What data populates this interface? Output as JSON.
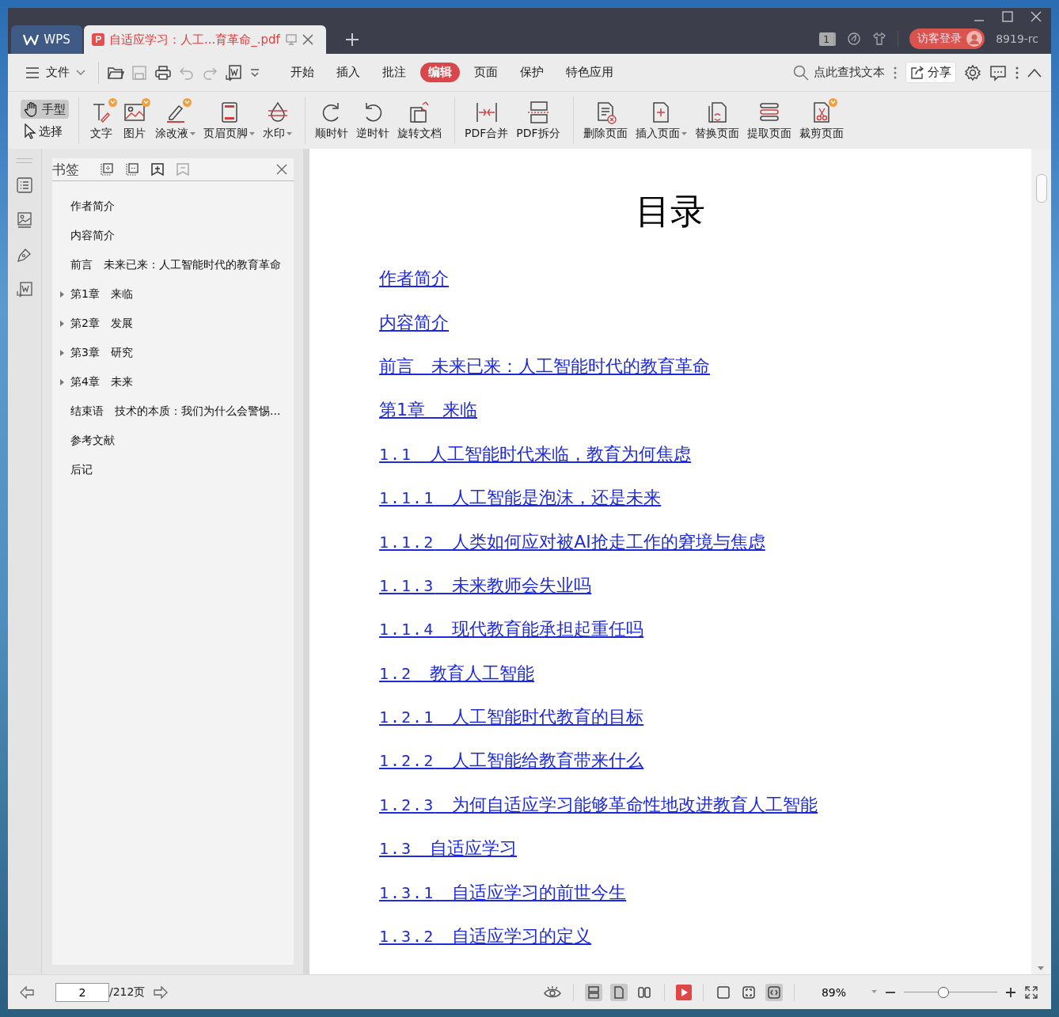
{
  "window": {
    "tabs": [
      {
        "kind": "home",
        "label": "WPS",
        "selected": false
      },
      {
        "kind": "pdf",
        "label": "自适应学习：人工...育革命_.pdf",
        "selected": true
      }
    ],
    "badge": "1",
    "login": "访客登录",
    "user": "8919-rc"
  },
  "menu": {
    "file": "文件",
    "tabs": [
      {
        "label": "开始",
        "selected": false
      },
      {
        "label": "插入",
        "selected": false
      },
      {
        "label": "批注",
        "selected": false
      },
      {
        "label": "编辑",
        "selected": true
      },
      {
        "label": "页面",
        "selected": false
      },
      {
        "label": "保护",
        "selected": false
      },
      {
        "label": "特色应用",
        "selected": false
      }
    ],
    "search": "点此查找文本",
    "share": "分享"
  },
  "toolbar": {
    "modes": [
      {
        "kind": "hand",
        "label": "手型",
        "selected": true
      },
      {
        "kind": "select",
        "label": "选择",
        "selected": false
      }
    ],
    "groups": [
      [
        {
          "kind": "text",
          "label": "文字",
          "dropdown": false,
          "badge": true
        },
        {
          "kind": "image",
          "label": "图片",
          "dropdown": false,
          "badge": true
        },
        {
          "kind": "correction",
          "label": "涂改液",
          "dropdown": true,
          "badge": true
        },
        {
          "kind": "header",
          "label": "页眉页脚",
          "dropdown": true,
          "badge": false
        },
        {
          "kind": "watermark",
          "label": "水印",
          "dropdown": true,
          "badge": false
        }
      ],
      [
        {
          "kind": "cw",
          "label": "顺时针",
          "dropdown": false,
          "badge": false
        },
        {
          "kind": "ccw",
          "label": "逆时针",
          "dropdown": false,
          "badge": false
        },
        {
          "kind": "rotate",
          "label": "旋转文档",
          "dropdown": false,
          "badge": false
        }
      ],
      [
        {
          "kind": "merge",
          "label": "PDF合并",
          "dropdown": false,
          "badge": false
        },
        {
          "kind": "split",
          "label": "PDF拆分",
          "dropdown": false,
          "badge": false
        }
      ],
      [
        {
          "kind": "delete",
          "label": "删除页面",
          "dropdown": false,
          "badge": false
        },
        {
          "kind": "insert",
          "label": "插入页面",
          "dropdown": true,
          "badge": false
        },
        {
          "kind": "replace",
          "label": "替换页面",
          "dropdown": false,
          "badge": false
        },
        {
          "kind": "extract",
          "label": "提取页面",
          "dropdown": false,
          "badge": false
        },
        {
          "kind": "crop",
          "label": "裁剪页面",
          "dropdown": false,
          "badge": true
        }
      ]
    ]
  },
  "bookmarks": {
    "title": "书签",
    "items": [
      {
        "label": "作者简介",
        "has_children": false
      },
      {
        "label": "内容简介",
        "has_children": false
      },
      {
        "label": "前言　未来已来：人工智能时代的教育革命",
        "has_children": false
      },
      {
        "label": "第1章　来临",
        "has_children": true
      },
      {
        "label": "第2章　发展",
        "has_children": true
      },
      {
        "label": "第3章　研究",
        "has_children": true
      },
      {
        "label": "第4章　未来",
        "has_children": true
      },
      {
        "label": "结束语　技术的本质：我们为什么会警惕...",
        "has_children": false
      },
      {
        "label": "参考文献",
        "has_children": false
      },
      {
        "label": "后记",
        "has_children": false
      }
    ]
  },
  "document": {
    "title": "目录",
    "toc": [
      {
        "kind": "plain",
        "text": "作者简介"
      },
      {
        "kind": "plain",
        "text": "内容简介"
      },
      {
        "kind": "plain",
        "text": "前言　未来已来：人工智能时代的教育革命"
      },
      {
        "kind": "plain",
        "text": "第1章　来临"
      },
      {
        "kind": "numbered",
        "number": "1.1",
        "text": "人工智能时代来临，教育为何焦虑"
      },
      {
        "kind": "numbered",
        "number": "1.1.1",
        "text": "人工智能是泡沫，还是未来"
      },
      {
        "kind": "numbered",
        "number": "1.1.2",
        "text": "人类如何应对被AI抢走工作的窘境与焦虑"
      },
      {
        "kind": "numbered",
        "number": "1.1.3",
        "text": "未来教师会失业吗"
      },
      {
        "kind": "numbered",
        "number": "1.1.4",
        "text": "现代教育能承担起重任吗"
      },
      {
        "kind": "numbered",
        "number": "1.2",
        "text": "教育人工智能"
      },
      {
        "kind": "numbered",
        "number": "1.2.1",
        "text": "人工智能时代教育的目标"
      },
      {
        "kind": "numbered",
        "number": "1.2.2",
        "text": "人工智能给教育带来什么"
      },
      {
        "kind": "numbered",
        "number": "1.2.3",
        "text": "为何自适应学习能够革命性地改进教育人工智能"
      },
      {
        "kind": "numbered",
        "number": "1.3",
        "text": "自适应学习"
      },
      {
        "kind": "numbered",
        "number": "1.3.1",
        "text": "自适应学习的前世今生"
      },
      {
        "kind": "numbered",
        "number": "1.3.2",
        "text": "自适应学习的定义"
      }
    ]
  },
  "status": {
    "page": "2",
    "total": "/212页",
    "layouts": [
      {
        "kind": "continuous",
        "selected": true
      },
      {
        "kind": "single",
        "selected": true
      },
      {
        "kind": "double",
        "selected": false
      }
    ],
    "fits": [
      {
        "kind": "actual",
        "selected": false
      },
      {
        "kind": "fit-page",
        "selected": false
      },
      {
        "kind": "fit-width",
        "selected": true
      }
    ],
    "zoom": "89%",
    "zoom_slider": {
      "level": 0.42
    }
  }
}
